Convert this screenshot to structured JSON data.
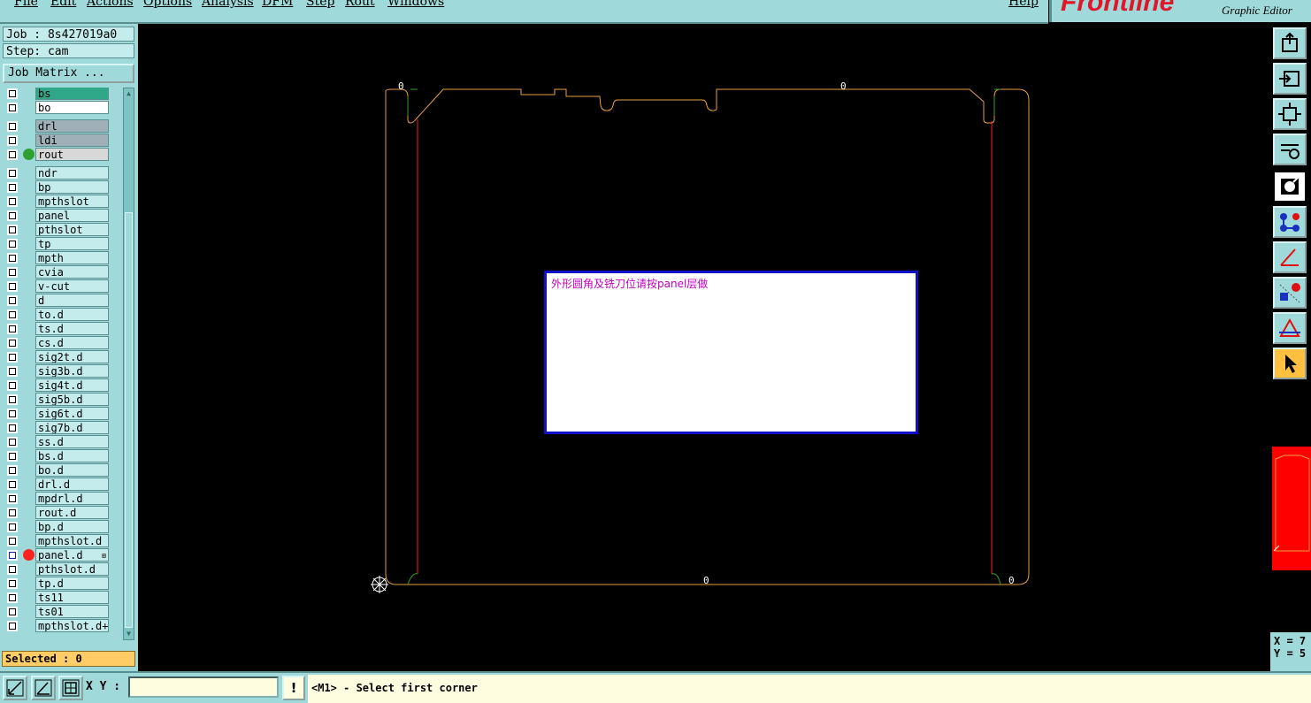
{
  "menu": [
    "File",
    "Edit",
    "Actions",
    "Options",
    "Analysis",
    "DFM",
    "Step",
    "Rout",
    "Windows",
    "Help"
  ],
  "brand": {
    "name": "Frontline",
    "subtitle": "Graphic Editor"
  },
  "job": {
    "job_label": "Job : 8s427019a0",
    "step_label": "Step: cam",
    "matrix_button": "Job Matrix ..."
  },
  "layers": [
    {
      "name": "bs",
      "color": "#2fa88a",
      "dot": null
    },
    {
      "name": "bo",
      "color": "#ffffff",
      "dot": null
    },
    {
      "name": "drl",
      "color": "#9fb0b8",
      "dot": null
    },
    {
      "name": "ldi",
      "color": "#9fb0b8",
      "dot": null
    },
    {
      "name": "rout",
      "color": "#d8d8d8",
      "dot": "#30a030"
    },
    {
      "name": "ndr",
      "color": "#c5ecec",
      "dot": null
    },
    {
      "name": "bp",
      "color": "#c5ecec",
      "dot": null
    },
    {
      "name": "mpthslot",
      "color": "#c5ecec",
      "dot": null
    },
    {
      "name": "panel",
      "color": "#c5ecec",
      "dot": null
    },
    {
      "name": "pthslot",
      "color": "#c5ecec",
      "dot": null
    },
    {
      "name": "tp",
      "color": "#c5ecec",
      "dot": null
    },
    {
      "name": "mpth",
      "color": "#c5ecec",
      "dot": null
    },
    {
      "name": "cvia",
      "color": "#c5ecec",
      "dot": null
    },
    {
      "name": "v-cut",
      "color": "#c5ecec",
      "dot": null
    },
    {
      "name": "d",
      "color": "#c5ecec",
      "dot": null
    },
    {
      "name": "to.d",
      "color": "#c5ecec",
      "dot": null
    },
    {
      "name": "ts.d",
      "color": "#c5ecec",
      "dot": null
    },
    {
      "name": "cs.d",
      "color": "#c5ecec",
      "dot": null
    },
    {
      "name": "sig2t.d",
      "color": "#c5ecec",
      "dot": null
    },
    {
      "name": "sig3b.d",
      "color": "#c5ecec",
      "dot": null
    },
    {
      "name": "sig4t.d",
      "color": "#c5ecec",
      "dot": null
    },
    {
      "name": "sig5b.d",
      "color": "#c5ecec",
      "dot": null
    },
    {
      "name": "sig6t.d",
      "color": "#c5ecec",
      "dot": null
    },
    {
      "name": "sig7b.d",
      "color": "#c5ecec",
      "dot": null
    },
    {
      "name": "ss.d",
      "color": "#c5ecec",
      "dot": null
    },
    {
      "name": "bs.d",
      "color": "#c5ecec",
      "dot": null
    },
    {
      "name": "bo.d",
      "color": "#c5ecec",
      "dot": null
    },
    {
      "name": "drl.d",
      "color": "#c5ecec",
      "dot": null
    },
    {
      "name": "mpdrl.d",
      "color": "#c5ecec",
      "dot": null
    },
    {
      "name": "rout.d",
      "color": "#c5ecec",
      "dot": null
    },
    {
      "name": "bp.d",
      "color": "#c5ecec",
      "dot": null
    },
    {
      "name": "mpthslot.d",
      "color": "#c5ecec",
      "dot": null
    },
    {
      "name": "panel.d",
      "color": "#c5ecec",
      "dot": "#ff2020",
      "selected": true,
      "mark": "⊞"
    },
    {
      "name": "pthslot.d",
      "color": "#c5ecec",
      "dot": null
    },
    {
      "name": "tp.d",
      "color": "#c5ecec",
      "dot": null
    },
    {
      "name": "ts11",
      "color": "#c5ecec",
      "dot": null
    },
    {
      "name": "ts01",
      "color": "#c5ecec",
      "dot": null
    },
    {
      "name": "mpthslot.d+",
      "color": "#c5ecec",
      "dot": null
    }
  ],
  "selected_label": "Selected : 0",
  "canvas": {
    "labels": [
      "0",
      "0",
      "0",
      "0"
    ],
    "message": "外形圆角及铣刀位请按panel层做",
    "outline_color": "#e8a040",
    "inner_color": "#ff2020"
  },
  "coords": {
    "x": "X = 7",
    "y": "Y = 5"
  },
  "bottom": {
    "xy_label": "X Y :",
    "xy_value": "",
    "warn": "!",
    "prompt": "<M1> - Select first corner"
  }
}
